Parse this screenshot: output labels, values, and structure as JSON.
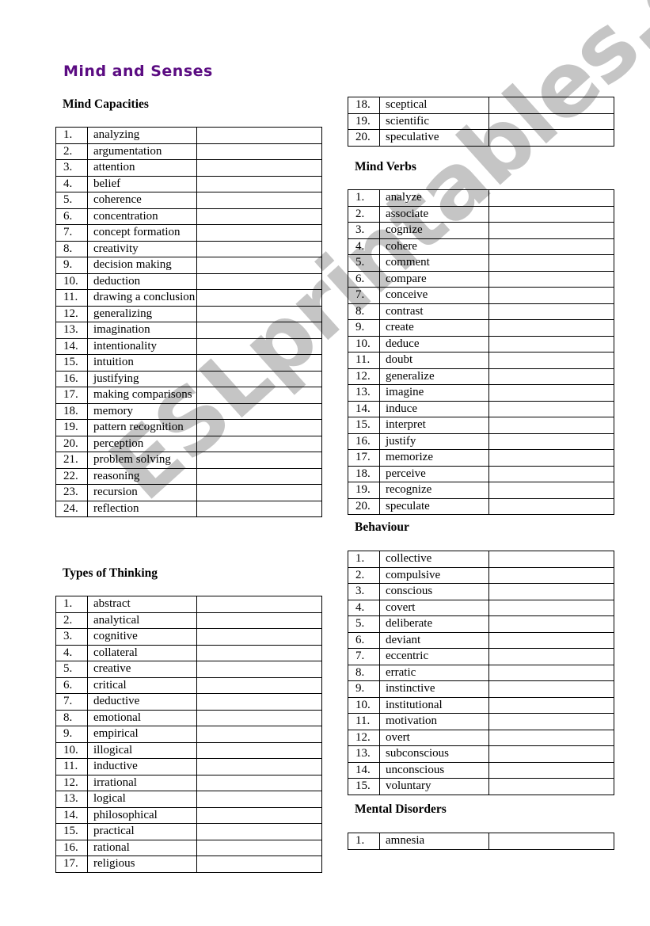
{
  "title": "Mind and Senses",
  "watermark": "ESLprintables.com",
  "colors": {
    "title": "#5b0c82",
    "watermark": "#969696"
  },
  "sections": [
    {
      "id": "mind-capacities",
      "heading": "Mind Capacities",
      "start": 1,
      "items": [
        "analyzing",
        "argumentation",
        "attention",
        "belief",
        "coherence",
        "concentration",
        "concept formation",
        "creativity",
        "decision making",
        "deduction",
        "drawing a conclusion",
        "generalizing",
        "imagination",
        "intentionality",
        "intuition",
        "justifying",
        "making comparisons",
        "memory",
        "pattern recognition",
        "perception",
        "problem solving",
        "reasoning",
        "recursion",
        "reflection"
      ]
    },
    {
      "id": "types-of-thinking",
      "heading": "Types of Thinking",
      "start": 1,
      "items": [
        "abstract",
        "analytical",
        "cognitive",
        "collateral",
        "creative",
        "critical",
        "deductive",
        "emotional",
        "empirical",
        "illogical",
        "inductive",
        "irrational",
        "logical",
        "philosophical",
        "practical",
        "rational",
        "religious"
      ]
    },
    {
      "id": "types-of-thinking-continued",
      "heading": "",
      "start": 18,
      "items": [
        "sceptical",
        "scientific",
        "speculative"
      ]
    },
    {
      "id": "mind-verbs",
      "heading": "Mind Verbs",
      "start": 1,
      "items": [
        "analyze",
        "associate",
        "cognize",
        "cohere",
        "comment",
        "compare",
        "conceive",
        "contrast",
        "create",
        "deduce",
        "doubt",
        "generalize",
        "imagine",
        "induce",
        "interpret",
        "justify",
        "memorize",
        "perceive",
        "recognize",
        "speculate"
      ]
    },
    {
      "id": "behaviour",
      "heading": "Behaviour",
      "start": 1,
      "items": [
        "collective",
        "compulsive",
        "conscious",
        "covert",
        "deliberate",
        "deviant",
        "eccentric",
        "erratic",
        "instinctive",
        "institutional",
        "motivation",
        "overt",
        "subconscious",
        "unconscious",
        "voluntary"
      ]
    },
    {
      "id": "mental-disorders",
      "heading": "Mental Disorders",
      "start": 1,
      "items": [
        "amnesia"
      ]
    }
  ]
}
